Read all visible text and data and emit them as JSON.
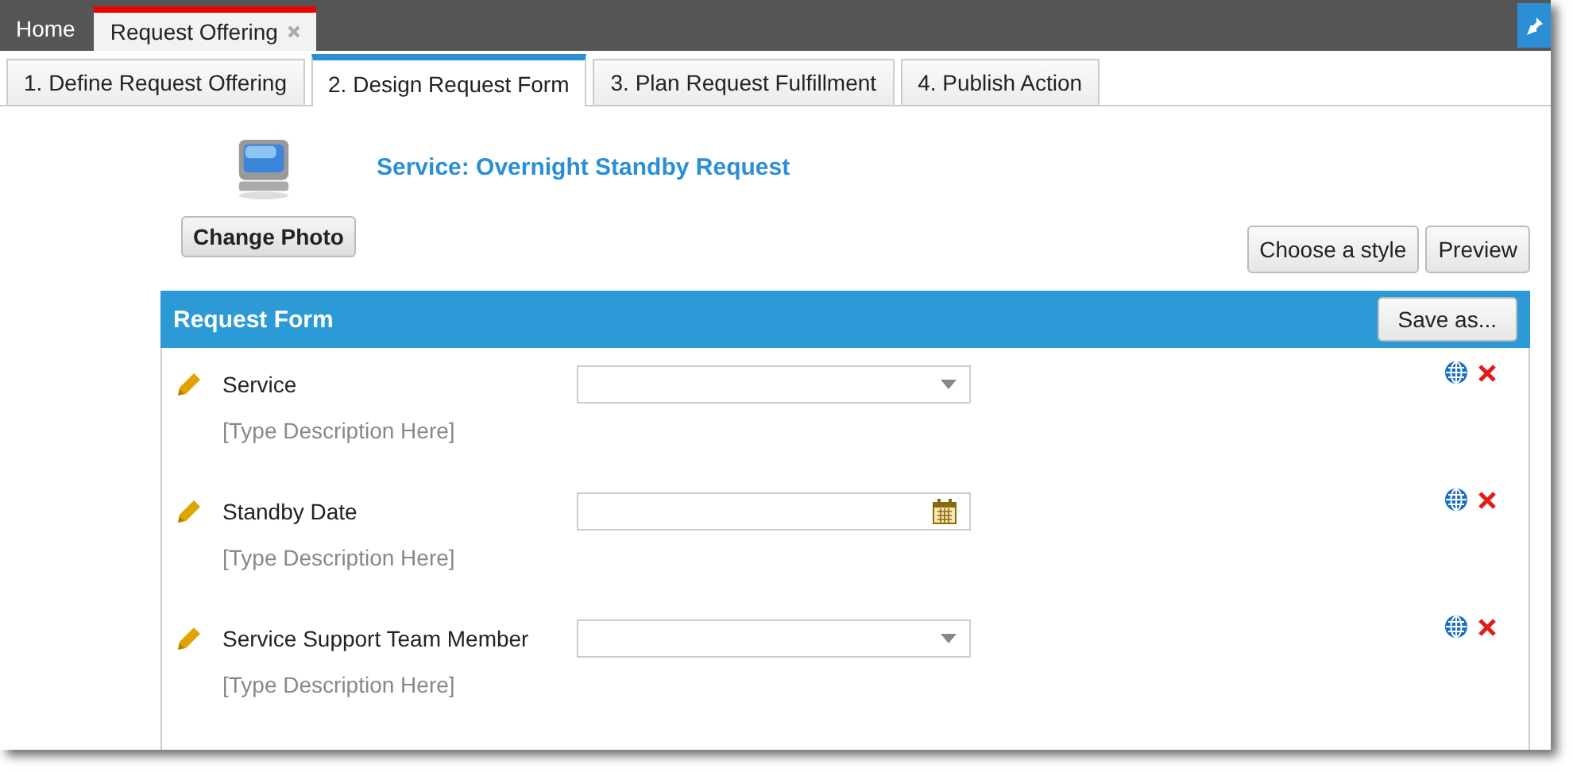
{
  "top_tabs": [
    {
      "label": "Home",
      "selected": false,
      "closable": false
    },
    {
      "label": "Request Offering",
      "selected": true,
      "closable": true
    }
  ],
  "steps": [
    {
      "label": "1. Define Request Offering",
      "selected": false
    },
    {
      "label": "2. Design Request Form",
      "selected": true
    },
    {
      "label": "3. Plan Request Fulfillment",
      "selected": false
    },
    {
      "label": "4. Publish Action",
      "selected": false
    }
  ],
  "header": {
    "title": "Service: Overnight Standby Request",
    "photo_button": "Change Photo"
  },
  "toolbar": [
    "Choose a style",
    "Preview"
  ],
  "form": {
    "title": "Request Form",
    "save_button": "Save as...",
    "fields": [
      {
        "label": "Service",
        "description": "[Type Description Here]",
        "kind": "dropdown"
      },
      {
        "label": "Standby Date",
        "description": "[Type Description Here]",
        "kind": "date"
      },
      {
        "label": "Service Support Team Member",
        "description": "[Type Description Here]",
        "kind": "dropdown"
      }
    ]
  }
}
